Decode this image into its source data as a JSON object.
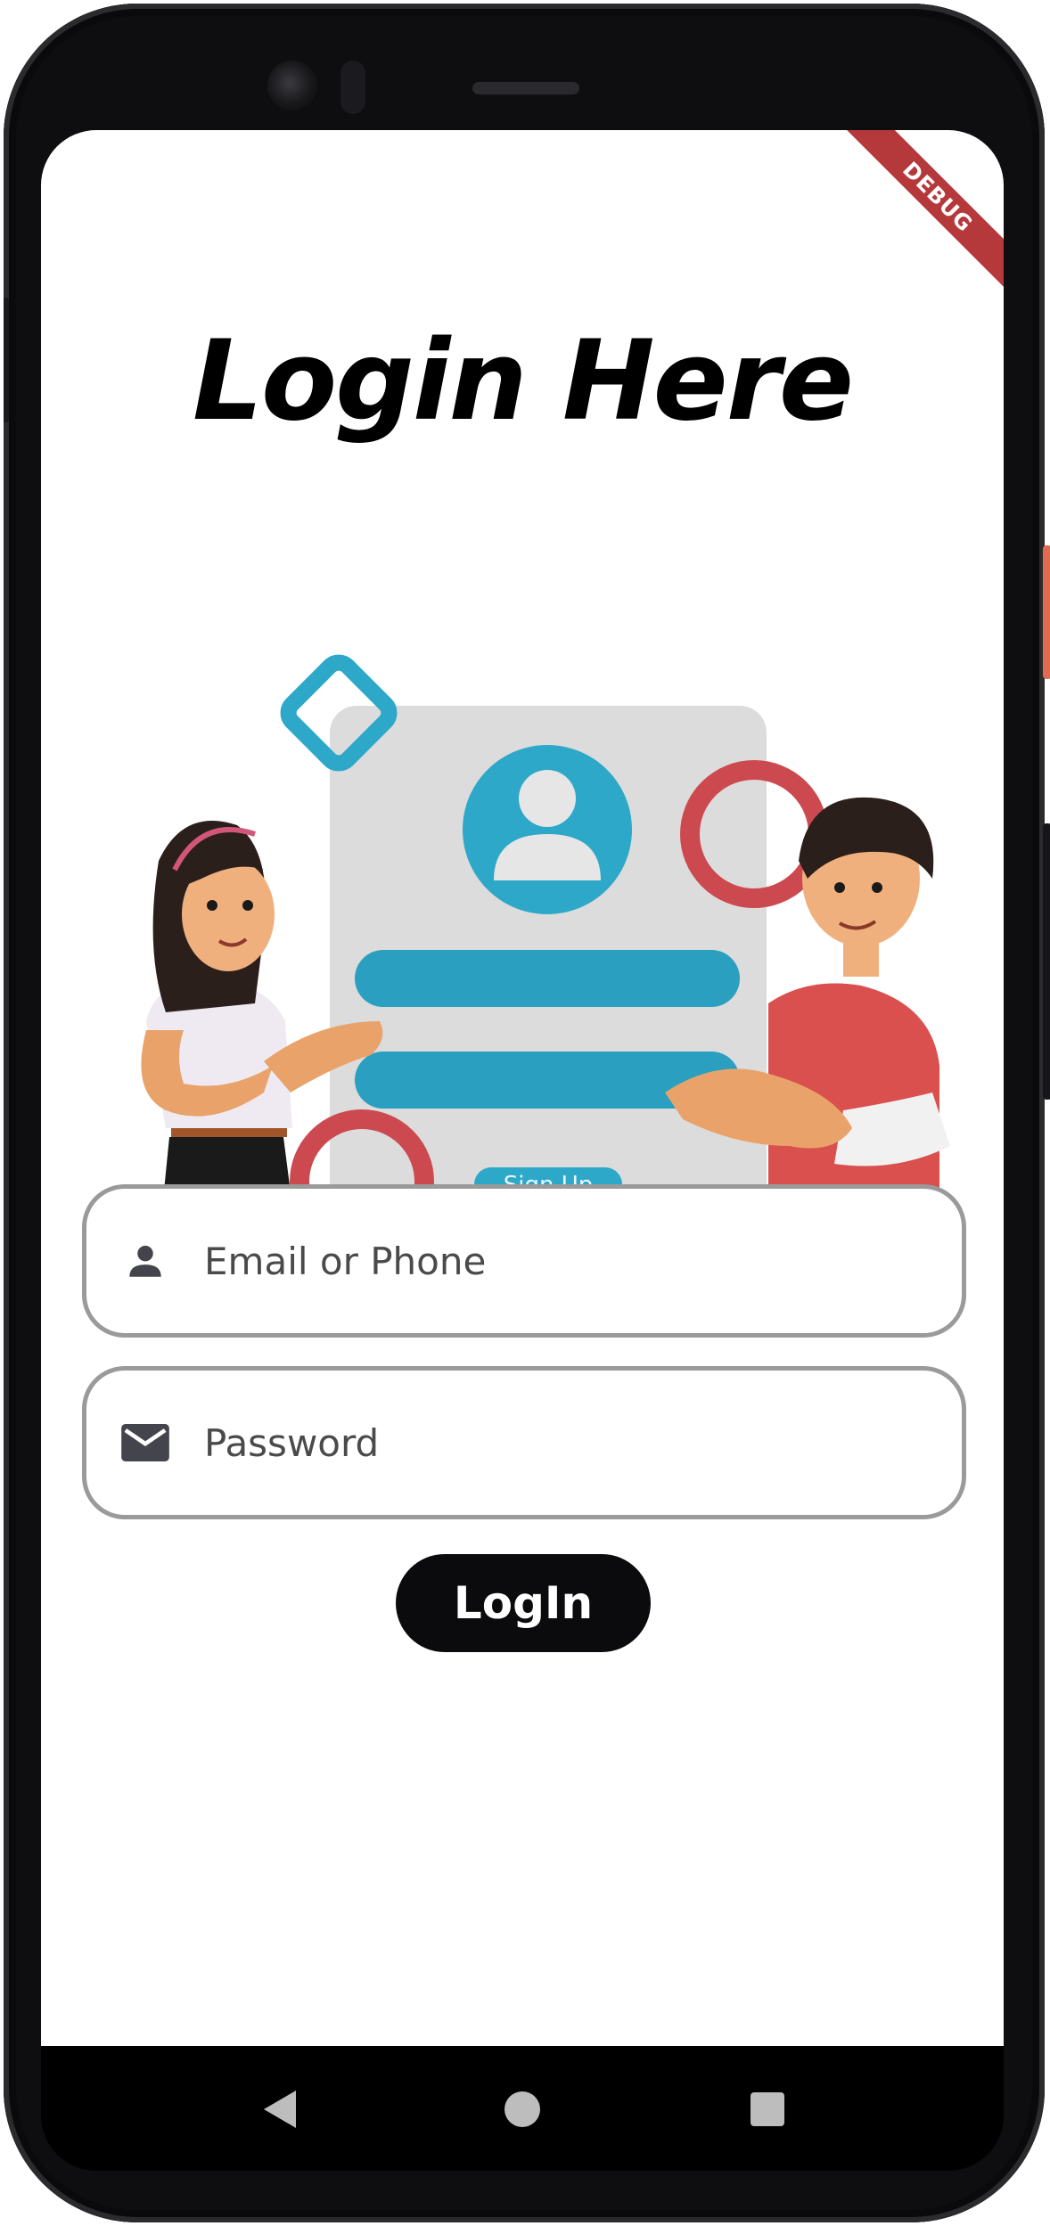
{
  "debug_banner": "DEBUG",
  "page_title": "Login Here",
  "illustration": {
    "card_button_label": "Sign Up",
    "accent_blue": "#2ea8c9",
    "accent_red": "#cc4a4f"
  },
  "email_field": {
    "icon": "person-icon",
    "placeholder": "Email or Phone"
  },
  "password_field": {
    "icon": "mail-icon",
    "placeholder": "Password"
  },
  "login_button": {
    "label": "LogIn"
  },
  "nav": {
    "back": "back-icon",
    "home": "home-icon",
    "recent": "recent-apps-icon"
  }
}
